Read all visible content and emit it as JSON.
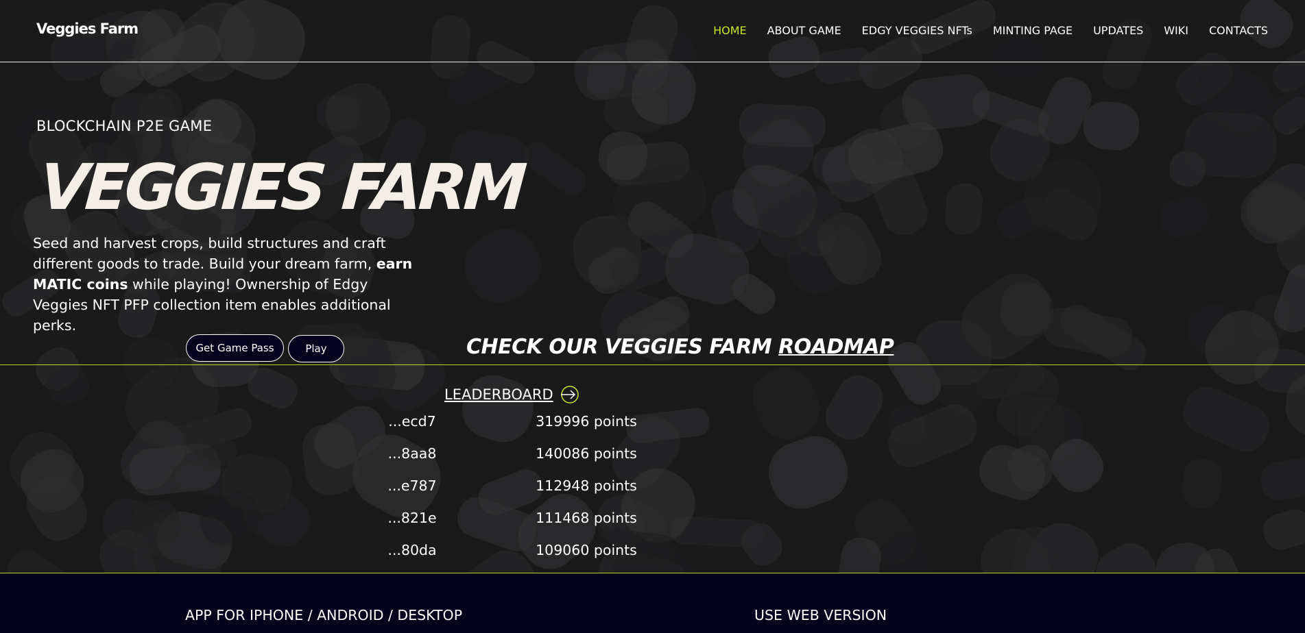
{
  "header": {
    "brand": "Veggies Farm",
    "nav": [
      "HOME",
      "ABOUT GAME",
      "EDGY VEGGIES NFTs",
      "MINTING PAGE",
      "UPDATES",
      "WIKI",
      "CONTACTS"
    ],
    "active": "HOME"
  },
  "hero": {
    "eyebrow": "BLOCKCHAIN P2E GAME",
    "title": "VEGGIES FARM",
    "desc_1": "Seed and harvest crops, build structures and craft different goods to trade. Build your dream farm, ",
    "desc_bold": "earn MATIC coins",
    "desc_2": " while playing! Ownership of Edgy Veggies NFT PFP collection item enables additional perks.",
    "btn_pass": "Get Game Pass",
    "btn_play": "Play"
  },
  "roadmap": {
    "prefix": "CHECK OUR VEGGIES FARM ",
    "link": "ROADMAP"
  },
  "leaderboard": {
    "title": "LEADERBOARD",
    "rows": [
      {
        "addr": "...ecd7",
        "points": "319996 points"
      },
      {
        "addr": "...8aa8",
        "points": "140086 points"
      },
      {
        "addr": "...e787",
        "points": "112948 points"
      },
      {
        "addr": "...821e",
        "points": "111468 points"
      },
      {
        "addr": "...80da",
        "points": "109060 points"
      }
    ]
  },
  "footer": {
    "app_label": "APP FOR IPHONE / ANDROID / DESKTOP",
    "web_label": "USE WEB VERSION"
  },
  "colors": {
    "accent": "#c8e628",
    "background": "#1a1a1b",
    "footer": "#04021a",
    "button_fill": "#05031e"
  }
}
